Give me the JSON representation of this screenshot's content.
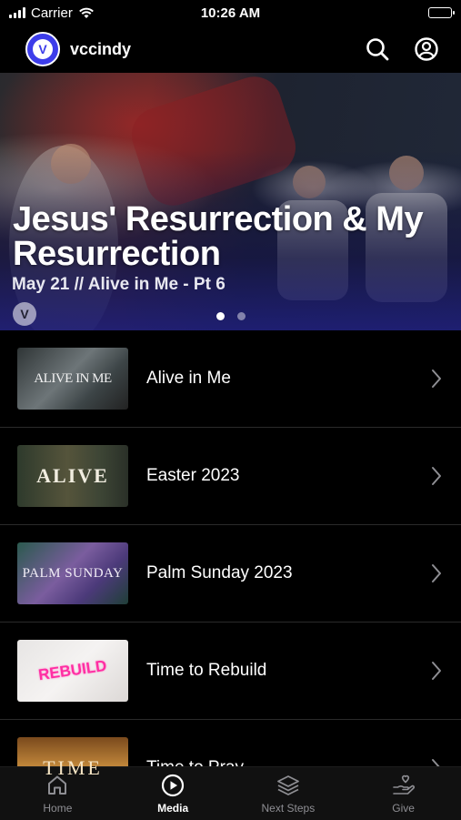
{
  "status_bar": {
    "carrier": "Carrier",
    "time": "10:26 AM"
  },
  "header": {
    "app_name": "vccindy",
    "logo_letter": "V",
    "search_icon": "search-icon",
    "profile_icon": "user-circle-icon"
  },
  "hero": {
    "title": "Jesus' Resurrection & My Resurrection",
    "subtitle": "May 21 // Alive in Me - Pt 6",
    "badge_letter": "V",
    "slide_count": 2,
    "active_slide": 1
  },
  "series": [
    {
      "title": "Alive in Me",
      "thumb_text": "ALIVE IN ME"
    },
    {
      "title": "Easter 2023",
      "thumb_text": "ALIVE"
    },
    {
      "title": "Palm Sunday 2023",
      "thumb_text": "PALM SUNDAY"
    },
    {
      "title": "Time to Rebuild",
      "thumb_text": "REBUILD"
    },
    {
      "title": "Time to Pray",
      "thumb_text": "TIME"
    }
  ],
  "tabs": [
    {
      "label": "Home",
      "icon": "home-icon"
    },
    {
      "label": "Media",
      "icon": "play-circle-icon",
      "active": true
    },
    {
      "label": "Next Steps",
      "icon": "stack-icon"
    },
    {
      "label": "Give",
      "icon": "heart-hand-icon"
    }
  ],
  "colors": {
    "accent": "#3d3dea",
    "background": "#000000",
    "tab_bar": "#111111",
    "inactive_tab": "#8e8e93"
  }
}
